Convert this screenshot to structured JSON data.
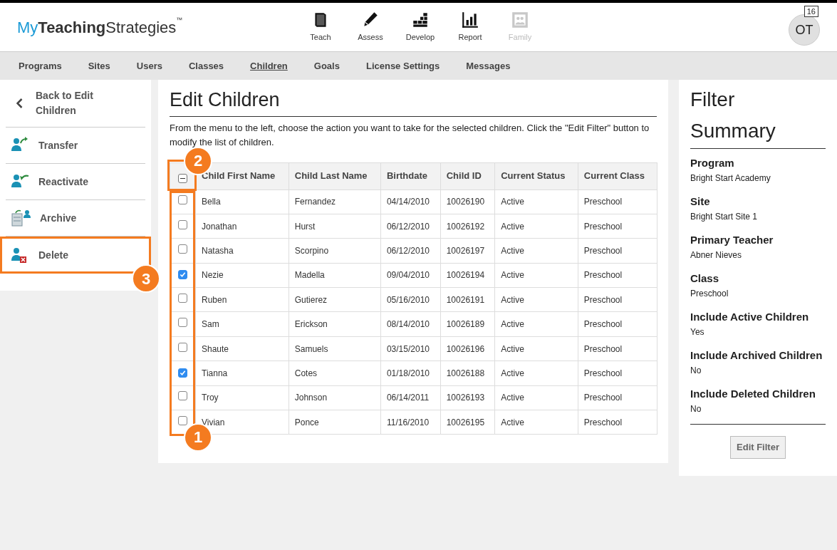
{
  "logo": {
    "prefix": "My",
    "bold": "Teaching",
    "suffix": "Strategies",
    "mark": "™"
  },
  "top_nav": [
    {
      "label": "Teach",
      "kind": "book",
      "disabled": false
    },
    {
      "label": "Assess",
      "kind": "pencil",
      "disabled": false
    },
    {
      "label": "Develop",
      "kind": "steps",
      "disabled": false
    },
    {
      "label": "Report",
      "kind": "chart",
      "disabled": false
    },
    {
      "label": "Family",
      "kind": "picture",
      "disabled": true
    }
  ],
  "user": {
    "initials": "OT",
    "badge": "16"
  },
  "tabs": [
    {
      "label": "Programs",
      "selected": false
    },
    {
      "label": "Sites",
      "selected": false
    },
    {
      "label": "Users",
      "selected": false
    },
    {
      "label": "Classes",
      "selected": false
    },
    {
      "label": "Children",
      "selected": true
    },
    {
      "label": "Goals",
      "selected": false
    },
    {
      "label": "License Settings",
      "selected": false
    },
    {
      "label": "Messages",
      "selected": false
    }
  ],
  "sidebar": {
    "items": [
      {
        "label": "Back to Edit Children",
        "kind": "back"
      },
      {
        "label": "Transfer",
        "kind": "transfer"
      },
      {
        "label": "Reactivate",
        "kind": "reactivate"
      },
      {
        "label": "Archive",
        "kind": "archive"
      },
      {
        "label": "Delete",
        "kind": "delete"
      }
    ]
  },
  "main": {
    "title": "Edit Children",
    "description": "From the menu to the left, choose the action you want to take for the selected children. Click the \"Edit Filter\" button to modify the list of children.",
    "table": {
      "select_all": {
        "indeterminate": true
      },
      "columns": [
        "Child First Name",
        "Child Last Name",
        "Birthdate",
        "Child ID",
        "Current Status",
        "Current Class"
      ],
      "rows": [
        {
          "checked": false,
          "cells": [
            "Bella",
            "Fernandez",
            "04/14/2010",
            "10026190",
            "Active",
            "Preschool"
          ]
        },
        {
          "checked": false,
          "cells": [
            "Jonathan",
            "Hurst",
            "06/12/2010",
            "10026192",
            "Active",
            "Preschool"
          ]
        },
        {
          "checked": false,
          "cells": [
            "Natasha",
            "Scorpino",
            "06/12/2010",
            "10026197",
            "Active",
            "Preschool"
          ]
        },
        {
          "checked": true,
          "cells": [
            "Nezie",
            "Madella",
            "09/04/2010",
            "10026194",
            "Active",
            "Preschool"
          ]
        },
        {
          "checked": false,
          "cells": [
            "Ruben",
            "Gutierez",
            "05/16/2010",
            "10026191",
            "Active",
            "Preschool"
          ]
        },
        {
          "checked": false,
          "cells": [
            "Sam",
            "Erickson",
            "08/14/2010",
            "10026189",
            "Active",
            "Preschool"
          ]
        },
        {
          "checked": false,
          "cells": [
            "Shaute",
            "Samuels",
            "03/15/2010",
            "10026196",
            "Active",
            "Preschool"
          ]
        },
        {
          "checked": true,
          "cells": [
            "Tianna",
            "Cotes",
            "01/18/2010",
            "10026188",
            "Active",
            "Preschool"
          ]
        },
        {
          "checked": false,
          "cells": [
            "Troy",
            "Johnson",
            "06/14/2011",
            "10026193",
            "Active",
            "Preschool"
          ]
        },
        {
          "checked": false,
          "cells": [
            "Vivian",
            "Ponce",
            "11/16/2010",
            "10026195",
            "Active",
            "Preschool"
          ]
        }
      ]
    }
  },
  "filter_summary": {
    "title": "Filter Summary",
    "fields": [
      {
        "label": "Program",
        "value": "Bright Start Academy"
      },
      {
        "label": "Site",
        "value": "Bright Start Site 1"
      },
      {
        "label": "Primary Teacher",
        "value": "Abner Nieves"
      },
      {
        "label": "Class",
        "value": "Preschool"
      },
      {
        "label": "Include Active Children",
        "value": "Yes"
      },
      {
        "label": "Include Archived Children",
        "value": "No"
      },
      {
        "label": "Include Deleted Children",
        "value": "No"
      }
    ],
    "button": "Edit Filter"
  },
  "callouts": {
    "checkbox_column": "1",
    "select_all": "2",
    "delete_item": "3"
  }
}
